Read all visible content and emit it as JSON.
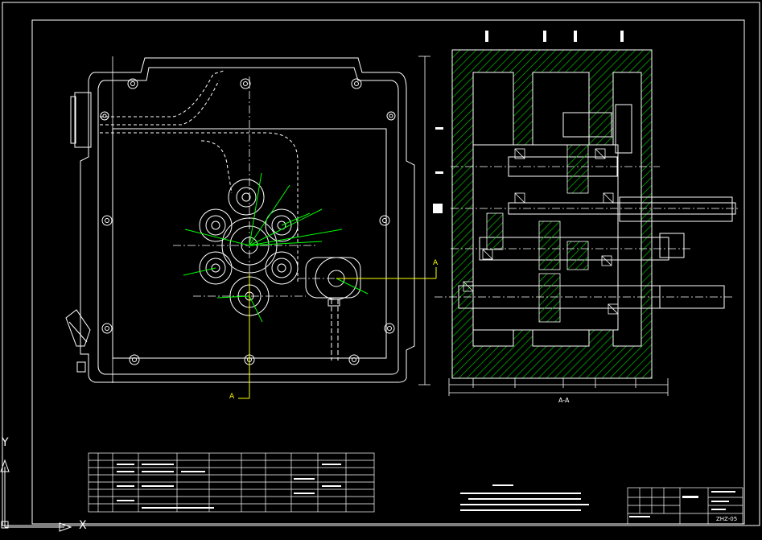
{
  "ucs": {
    "x_axis": "X",
    "y_axis": "Y"
  },
  "section_marks": {
    "left_top": "A",
    "left_bottom": "A",
    "section_title": "A-A"
  },
  "title_block": {
    "drawing_no": "ZHZ-05"
  },
  "colors": {
    "background": "#000000",
    "line": "#ffffff",
    "accent": "#ffff00",
    "gear_leader": "#00ff00",
    "hatch": "#00ff00",
    "center_line": "#ffffff"
  }
}
